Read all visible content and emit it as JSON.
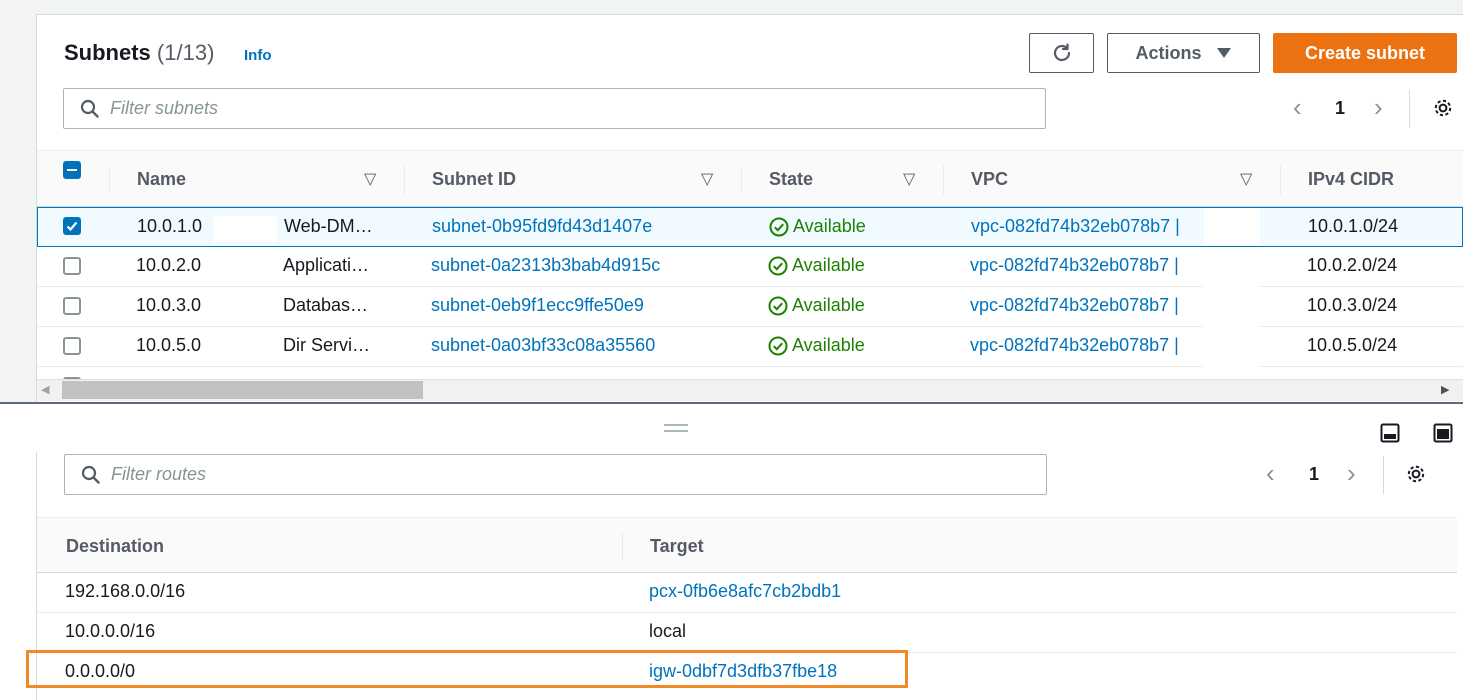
{
  "header": {
    "title": "Subnets",
    "count": "(1/13)",
    "info": "Info",
    "actions_label": "Actions",
    "create_label": "Create subnet"
  },
  "subnet_search": {
    "placeholder": "Filter subnets"
  },
  "subnet_pager": {
    "page": "1"
  },
  "subnet_table": {
    "columns": [
      "Name",
      "Subnet ID",
      "State",
      "VPC",
      "IPv4 CIDR"
    ],
    "rows": [
      {
        "name_prefix": "10.0.1.0",
        "name_suffix": "Web-DM…",
        "subnet_id": "subnet-0b95fd9fd43d1407e",
        "state": "Available",
        "vpc": "vpc-082fd74b32eb078b7 |",
        "cidr": "10.0.1.0/24",
        "selected": true
      },
      {
        "name_prefix": "10.0.2.0",
        "name_suffix": "Applicati…",
        "subnet_id": "subnet-0a2313b3bab4d915c",
        "state": "Available",
        "vpc": "vpc-082fd74b32eb078b7 |",
        "cidr": "10.0.2.0/24",
        "selected": false
      },
      {
        "name_prefix": "10.0.3.0",
        "name_suffix": "Databas…",
        "subnet_id": "subnet-0eb9f1ecc9ffe50e9",
        "state": "Available",
        "vpc": "vpc-082fd74b32eb078b7 |",
        "cidr": "10.0.3.0/24",
        "selected": false
      },
      {
        "name_prefix": "10.0.5.0",
        "name_suffix": "Dir Servi…",
        "subnet_id": "subnet-0a03bf33c08a35560",
        "state": "Available",
        "vpc": "vpc-082fd74b32eb078b7 |",
        "cidr": "10.0.5.0/24",
        "selected": false
      }
    ]
  },
  "route_search": {
    "placeholder": "Filter routes"
  },
  "route_pager": {
    "page": "1"
  },
  "routes_table": {
    "columns": [
      "Destination",
      "Target"
    ],
    "rows": [
      {
        "destination": "192.168.0.0/16",
        "target": "pcx-0fb6e8afc7cb2bdb1",
        "target_is_link": true
      },
      {
        "destination": "10.0.0.0/16",
        "target": "local",
        "target_is_link": false
      },
      {
        "destination": "0.0.0.0/0",
        "target": "igw-0dbf7d3dfb37fbe18",
        "target_is_link": true
      }
    ]
  },
  "colors": {
    "accent": "#0073bb",
    "primary_button": "#ec7211",
    "success": "#1d8102",
    "highlight": "#f08a24"
  }
}
